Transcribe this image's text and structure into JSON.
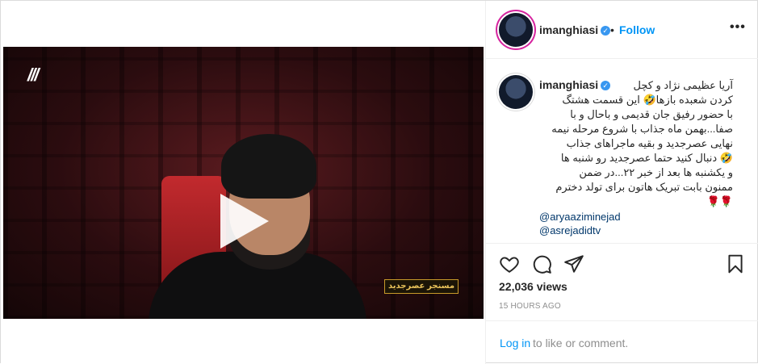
{
  "header": {
    "username": "imanghiasi",
    "separator": "•",
    "follow_label": "Follow",
    "more_label": "•••"
  },
  "media": {
    "channel_logo": "///",
    "show_tag": "مسنجر عصرجدید"
  },
  "comment": {
    "username": "imanghiasi",
    "caption_lines": [
      "آریا عظیمی نژاد و کچل",
      "کردن شعبده بازها🤣 این قسمت هشتگ",
      "با حضور رفیق جان قدیمی و باحال و با",
      "صفا...بهمن ماه جذاب با شروع مرحله نیمه",
      "نهایی عصرجدید و بقیه ماجراهای جذاب",
      "🤣 دنبال کنید حتما عصرجدید رو شنبه ها",
      "و یکشنبه ها بعد از خبر ۲۲...در ضمن",
      "ممنون بابت تبریک هاتون برای تولد دخترم",
      "🌹🌹"
    ],
    "mentions": [
      "@aryaaziminejad",
      "@asrejadidtv"
    ]
  },
  "stats": {
    "views": "22,036 views",
    "time": "15 HOURS AGO"
  },
  "login": {
    "link": "Log in",
    "rest": "to like or comment."
  },
  "colors": {
    "accent": "#0095f6",
    "mention": "#00376b",
    "verified": "#3897f0",
    "muted": "#8e8e8e"
  }
}
